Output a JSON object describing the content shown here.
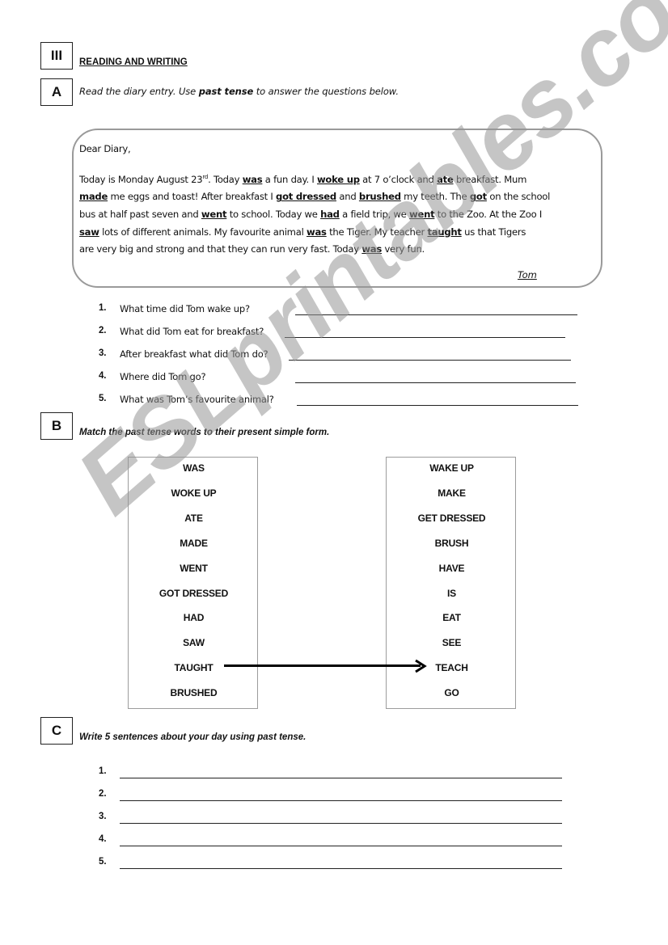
{
  "header": {
    "section_number": "III",
    "section_title": "READING AND WRITING"
  },
  "part_a": {
    "label": "A",
    "instruction_pre": "Read the diary entry. Use ",
    "instruction_bold": "past tense",
    "instruction_post": " to answer the questions below.",
    "diary": {
      "greeting": "Dear Diary,",
      "lines": [
        [
          {
            "t": "Today is Monday August 23"
          },
          {
            "t": "rd",
            "sup": true
          },
          {
            "t": ". Today "
          },
          {
            "t": "was",
            "b": true
          },
          {
            "t": " a fun day. I "
          },
          {
            "t": "woke up",
            "b": true
          },
          {
            "t": " at 7 o’clock and "
          },
          {
            "t": "ate",
            "b": true
          },
          {
            "t": " breakfast.  Mum"
          }
        ],
        [
          {
            "t": "made",
            "b": true
          },
          {
            "t": " me eggs and toast! After breakfast I "
          },
          {
            "t": "got dressed",
            "b": true
          },
          {
            "t": " and "
          },
          {
            "t": "brushed",
            "b": true
          },
          {
            "t": " my teeth. The "
          },
          {
            "t": "got",
            "b": true
          },
          {
            "t": " on the school"
          }
        ],
        [
          {
            "t": "bus at half past seven and "
          },
          {
            "t": "went",
            "b": true
          },
          {
            "t": " to school. Today we "
          },
          {
            "t": "had",
            "b": true
          },
          {
            "t": " a field trip, we "
          },
          {
            "t": "went",
            "b": true
          },
          {
            "t": " to the Zoo. At the Zoo I"
          }
        ],
        [
          {
            "t": "saw",
            "b": true
          },
          {
            "t": " lots of different animals. My favourite animal "
          },
          {
            "t": "was",
            "b": true
          },
          {
            "t": " the Tiger. My teacher "
          },
          {
            "t": "taught",
            "b": true
          },
          {
            "t": " us that Tigers"
          }
        ],
        [
          {
            "t": "are very big and strong and that they can run very fast. Today "
          },
          {
            "t": "was",
            "b": true
          },
          {
            "t": " very fun."
          }
        ]
      ],
      "signature": "Tom"
    },
    "questions": [
      {
        "num": "1.",
        "text": "What time did Tom  wake up?"
      },
      {
        "num": "2.",
        "text": "What did Tom  eat for breakfast?"
      },
      {
        "num": "3.",
        "text": "After breakfast what did Tom  do?"
      },
      {
        "num": "4.",
        "text": "Where did Tom  go?"
      },
      {
        "num": "5.",
        "text": "What was Tom’s favourite animal?"
      }
    ]
  },
  "part_b": {
    "label": "B",
    "instruction": "Match the past tense words to their present simple form.",
    "past_words": [
      "WAS",
      "WOKE UP",
      "ATE",
      "MADE",
      "WENT",
      "GOT DRESSED",
      "HAD",
      "SAW",
      "TAUGHT",
      "BRUSHED"
    ],
    "present_words": [
      "WAKE UP",
      "MAKE",
      "GET DRESSED",
      "BRUSH",
      "HAVE",
      "IS",
      "EAT",
      "SEE",
      "TEACH",
      "GO"
    ],
    "example_match": {
      "from": "TAUGHT",
      "to": "TEACH"
    }
  },
  "part_c": {
    "label": "C",
    "instruction": "Write 5 sentences about your day using past tense.",
    "lines": [
      "1.",
      "2.",
      "3.",
      "4.",
      "5."
    ]
  },
  "watermark": "ESLprintables.com"
}
